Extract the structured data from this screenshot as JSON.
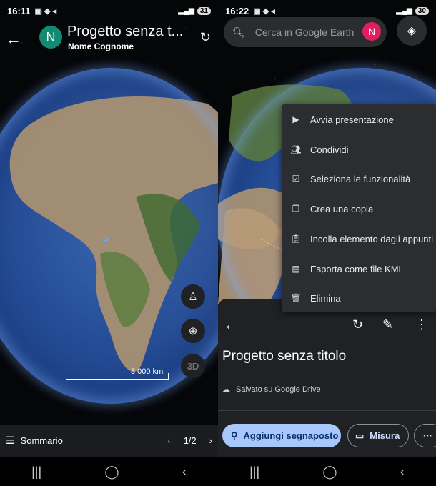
{
  "left": {
    "status": {
      "time": "16:11",
      "battery": "31"
    },
    "header": {
      "avatar_letter": "N",
      "title": "Progetto senza t...",
      "subtitle": "Nome Cognome"
    },
    "scale_label": "3 000 km",
    "fab_3d": "3D",
    "bottom": {
      "summary_label": "Sommario",
      "page": "1/2"
    }
  },
  "right": {
    "status": {
      "time": "16:22",
      "battery": "30"
    },
    "search": {
      "placeholder": "Cerca in Google Earth",
      "avatar_letter": "N"
    },
    "menu": [
      {
        "label": "Avvia presentazione",
        "icon": "play-icon"
      },
      {
        "label": "Condividi",
        "icon": "share-people-icon"
      },
      {
        "label": "Seleziona le funzionalità",
        "icon": "checkbox-icon"
      },
      {
        "label": "Crea una copia",
        "icon": "copy-icon"
      },
      {
        "label": "Incolla elemento dagli appunti",
        "icon": "clipboard-icon"
      },
      {
        "label": "Esporta come file KML",
        "icon": "kml-icon"
      },
      {
        "label": "Elimina",
        "icon": "trash-icon"
      }
    ],
    "project": {
      "title": "Progetto senza titolo",
      "saved": "Salvato su Google Drive"
    },
    "actions": {
      "add_placemark": "Aggiungi segnaposto",
      "measure": "Misura"
    }
  },
  "colors": {
    "avatar_left": "#138a72",
    "avatar_right": "#e0205e",
    "primary_chip": "#a8c7fa"
  }
}
